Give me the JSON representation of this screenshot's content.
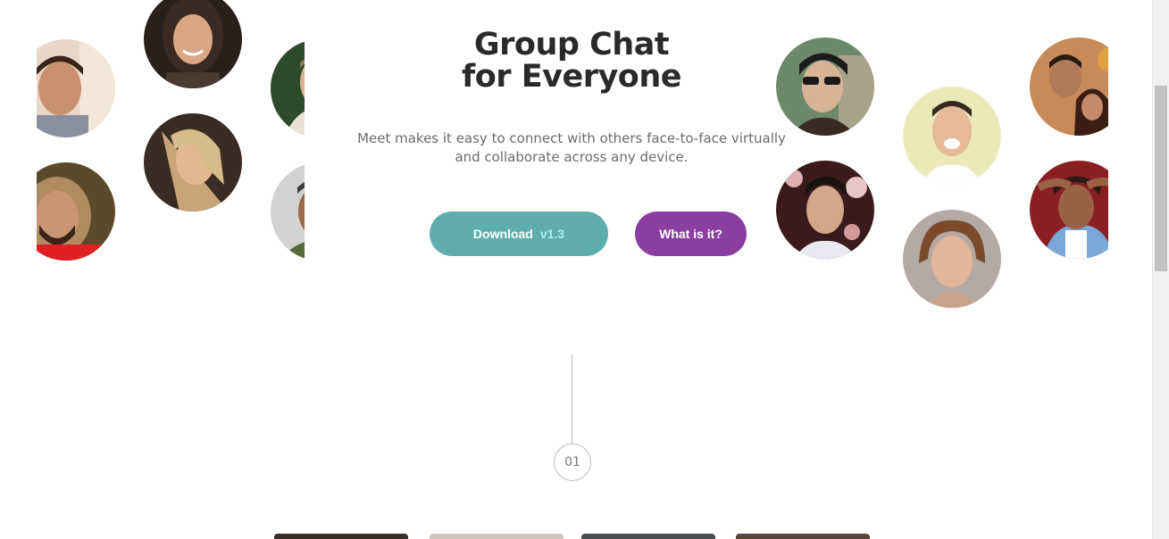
{
  "hero": {
    "title_line1": "Group Chat",
    "title_line2": "for Everyone",
    "subtitle_line1": "Meet makes it easy to connect with others face-to-face virtually",
    "subtitle_line2": "and collaborate across any device."
  },
  "buttons": {
    "download_label": "Download",
    "download_version": "v1.3",
    "what_label": "What is it?"
  },
  "step": {
    "number": "01"
  },
  "colors": {
    "title": "#2a2a2a",
    "subtitle": "#6b6b6b",
    "download_button": "#5fadad",
    "download_version": "#a9f5ec",
    "what_button": "#8a3fa0",
    "step_border": "#bdbdbd"
  }
}
